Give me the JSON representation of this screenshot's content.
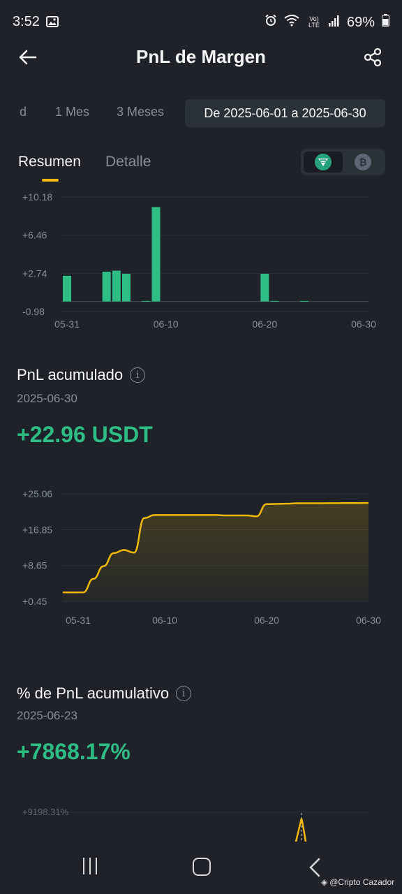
{
  "status_bar": {
    "time": "3:52",
    "battery": "69%",
    "network": "Vo) LTE"
  },
  "header": {
    "title": "PnL de Margen"
  },
  "range_tabs": {
    "partial_label": "d",
    "one_month": "1 Mes",
    "three_months": "3 Meses",
    "date_range": "De 2025-06-01 a 2025-06-30"
  },
  "view_tabs": {
    "summary": "Resumen",
    "detail": "Detalle"
  },
  "coin_toggle": {
    "selected": "usdt-icon",
    "unselected": "btc-icon"
  },
  "cumulative_pnl": {
    "title": "PnL acumulado",
    "date": "2025-06-30",
    "value": "+22.96 USDT"
  },
  "cumulative_pct": {
    "title": "% de PnL acumulativo",
    "date": "2025-06-23",
    "value": "+7868.17%"
  },
  "watermark": "@Cripto Cazador",
  "colors": {
    "background": "#1f2329",
    "positive": "#2ebd85",
    "accent": "#f0b90b",
    "muted": "#848e9c"
  },
  "chart_data": [
    {
      "type": "bar",
      "title": "",
      "yticks": [
        "+10.18",
        "+6.46",
        "+2.74",
        "-0.98"
      ],
      "ylim": [
        -0.98,
        10.18
      ],
      "xticks": [
        "05-31",
        "06-10",
        "06-20",
        "06-30"
      ],
      "x": [
        "05-31",
        "06-01",
        "06-02",
        "06-03",
        "06-04",
        "06-05",
        "06-06",
        "06-07",
        "06-08",
        "06-09",
        "06-10",
        "06-11",
        "06-12",
        "06-13",
        "06-14",
        "06-15",
        "06-16",
        "06-17",
        "06-18",
        "06-19",
        "06-20",
        "06-21",
        "06-22",
        "06-23",
        "06-24",
        "06-25",
        "06-26",
        "06-27",
        "06-28",
        "06-29",
        "06-30"
      ],
      "values": [
        2.5,
        0,
        0,
        0,
        2.9,
        3.0,
        2.7,
        0,
        0.05,
        9.2,
        0,
        0,
        0,
        0,
        0,
        0,
        0,
        0,
        0,
        0,
        2.7,
        0.05,
        0,
        0,
        0.05,
        0,
        0,
        0,
        0,
        0,
        0
      ],
      "color": "#2ebd85"
    },
    {
      "type": "area",
      "title": "",
      "yticks": [
        "+25.06",
        "+16.85",
        "+8.65",
        "+0.45"
      ],
      "ylim": [
        0.45,
        25.06
      ],
      "xticks": [
        "05-31",
        "06-10",
        "06-20",
        "06-30"
      ],
      "x": [
        "05-31",
        "06-01",
        "06-02",
        "06-03",
        "06-04",
        "06-05",
        "06-06",
        "06-07",
        "06-08",
        "06-09",
        "06-10",
        "06-11",
        "06-12",
        "06-13",
        "06-14",
        "06-15",
        "06-16",
        "06-17",
        "06-18",
        "06-19",
        "06-20",
        "06-21",
        "06-22",
        "06-23",
        "06-24",
        "06-25",
        "06-26",
        "06-27",
        "06-28",
        "06-29",
        "06-30"
      ],
      "values": [
        2.5,
        2.5,
        2.5,
        5.6,
        8.5,
        11.5,
        12.2,
        11.6,
        19.5,
        20.2,
        20.2,
        20.2,
        20.2,
        20.2,
        20.2,
        20.2,
        20.1,
        20.1,
        20.1,
        19.9,
        22.7,
        22.75,
        22.8,
        22.9,
        22.9,
        22.9,
        22.92,
        22.93,
        22.94,
        22.95,
        22.96
      ],
      "color": "#f0b90b"
    },
    {
      "type": "line",
      "title": "",
      "yticks": [
        "+9198.31%"
      ],
      "color": "#f0b90b"
    }
  ]
}
